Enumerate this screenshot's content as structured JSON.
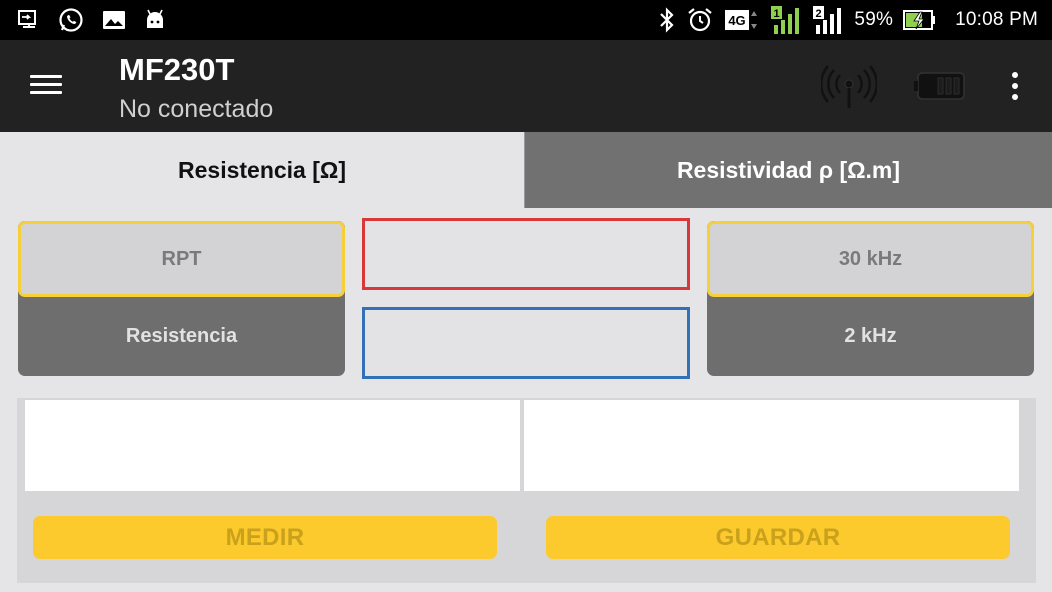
{
  "status_bar": {
    "battery_percent": "59%",
    "time": "10:08 PM",
    "network_label": "4G",
    "sim1_label": "1",
    "sim2_label": "2",
    "left_icons": [
      "usb-icon",
      "whatsapp-icon",
      "gallery-icon",
      "android-icon"
    ],
    "right_icons": [
      "bluetooth-icon",
      "alarm-icon",
      "network-4g-icon",
      "signal-sim1-icon",
      "signal-sim2-icon",
      "battery-charging-icon"
    ]
  },
  "app_bar": {
    "title": "MF230T",
    "subtitle": "No conectado",
    "icons": [
      "menu-icon",
      "antenna-icon",
      "battery-icon",
      "more-vert-icon"
    ]
  },
  "tabs": [
    {
      "label": "Resistencia [Ω]",
      "selected": true
    },
    {
      "label": "Resistividad ρ [Ω.m]",
      "selected": false
    }
  ],
  "mode_selector": {
    "options": [
      "RPT",
      "Resistencia"
    ],
    "selected": "RPT"
  },
  "frequency_selector": {
    "options": [
      "30 kHz",
      "2 kHz"
    ],
    "selected": "30 kHz"
  },
  "displays": {
    "primary_value": "",
    "secondary_value": ""
  },
  "results": {
    "left": "",
    "right": ""
  },
  "actions": {
    "measure_label": "MEDIR",
    "save_label": "GUARDAR"
  },
  "colors": {
    "app_bar_bg": "#222222",
    "accent_yellow": "#fcca2c",
    "selection_border": "#f6cf3b",
    "display_red": "#d8383a",
    "display_blue": "#3270b8",
    "inactive_tab": "#717171"
  }
}
